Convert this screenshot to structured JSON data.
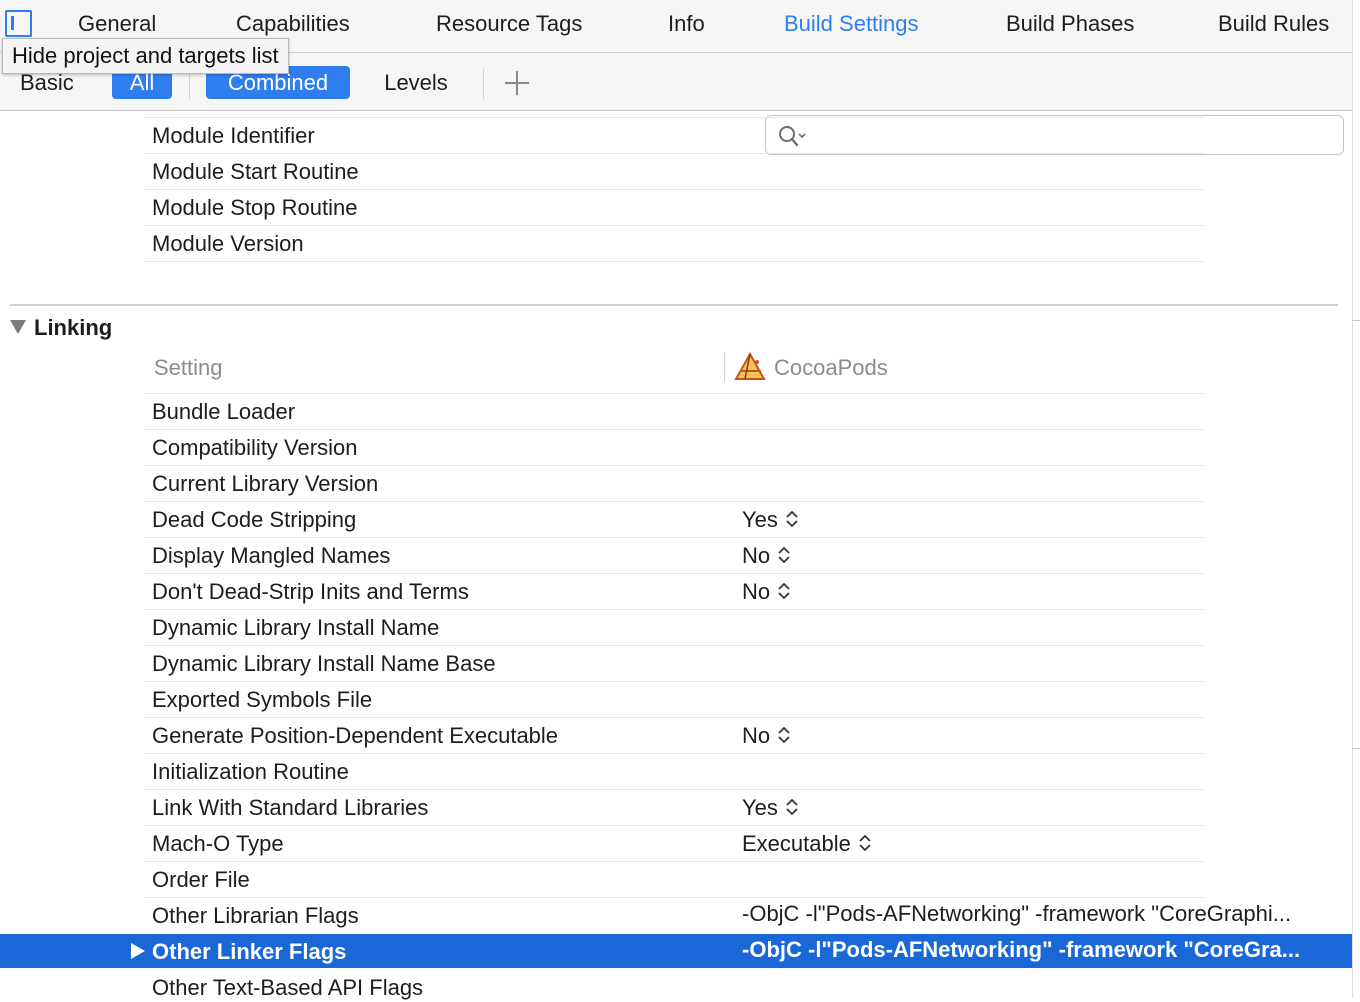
{
  "tabs": [
    "General",
    "Capabilities",
    "Resource Tags",
    "Info",
    "Build Settings",
    "Build Phases",
    "Build Rules"
  ],
  "active_tab": "Build Settings",
  "tooltip": "Hide project and targets list",
  "filters": {
    "basic": "Basic",
    "all": "All",
    "combined": "Combined",
    "levels": "Levels"
  },
  "search": {
    "value": "",
    "placeholder": ""
  },
  "module_settings": [
    "Module Identifier",
    "Module Start Routine",
    "Module Stop Routine",
    "Module Version"
  ],
  "linking": {
    "title": "Linking",
    "setting_header": "Setting",
    "target_header": "CocoaPods",
    "rows": [
      {
        "name": "Bundle Loader",
        "value": ""
      },
      {
        "name": "Compatibility Version",
        "value": ""
      },
      {
        "name": "Current Library Version",
        "value": ""
      },
      {
        "name": "Dead Code Stripping",
        "value": "Yes"
      },
      {
        "name": "Display Mangled Names",
        "value": "No"
      },
      {
        "name": "Don't Dead-Strip Inits and Terms",
        "value": "No"
      },
      {
        "name": "Dynamic Library Install Name",
        "value": ""
      },
      {
        "name": "Dynamic Library Install Name Base",
        "value": ""
      },
      {
        "name": "Exported Symbols File",
        "value": ""
      },
      {
        "name": "Generate Position-Dependent Executable",
        "value": "No"
      },
      {
        "name": "Initialization Routine",
        "value": ""
      },
      {
        "name": "Link With Standard Libraries",
        "value": "Yes"
      },
      {
        "name": "Mach-O Type",
        "value": "Executable"
      },
      {
        "name": "Order File",
        "value": ""
      },
      {
        "name": "Other Librarian Flags",
        "value": "-ObjC -l\"Pods-AFNetworking\" -framework \"CoreGraphi..."
      }
    ],
    "selected": {
      "name": "Other Linker Flags",
      "value": "-ObjC -l\"Pods-AFNetworking\" -framework \"CoreGra..."
    },
    "after": "Other Text-Based API Flags"
  }
}
